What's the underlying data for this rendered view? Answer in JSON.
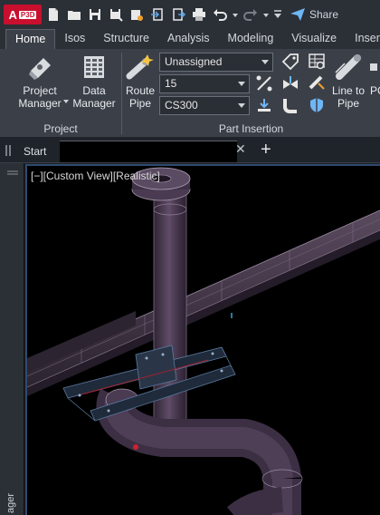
{
  "app": {
    "badge": "A",
    "product_tag": "P3D"
  },
  "qat": {
    "share_label": "Share"
  },
  "tabs": [
    {
      "label": "Home"
    },
    {
      "label": "Isos"
    },
    {
      "label": "Structure"
    },
    {
      "label": "Analysis"
    },
    {
      "label": "Modeling"
    },
    {
      "label": "Visualize"
    },
    {
      "label": "Insert"
    }
  ],
  "ribbon": {
    "project_panel": {
      "title": "Project",
      "project_manager_label": "Project\nManager",
      "data_manager_label": "Data\nManager"
    },
    "part_insertion_panel": {
      "title": "Part Insertion",
      "route_pipe_label": "Route\nPipe",
      "line_number_value": "Unassigned",
      "size_value": "15",
      "spec_value": "CS300",
      "line_to_pipe_label": "Line to\nPipe",
      "truncated_label": "PC"
    }
  },
  "file_tabs": {
    "start_label": "Start",
    "close_glyph": "✕",
    "new_glyph": "+"
  },
  "side_palette": {
    "label": "ager"
  },
  "viewport": {
    "view_label": "[−][Custom View][Realistic]"
  },
  "colors": {
    "accent": "#c8102e",
    "pipe": "#4a3a52",
    "background": "#000000",
    "ribbon": "#3b4048"
  }
}
